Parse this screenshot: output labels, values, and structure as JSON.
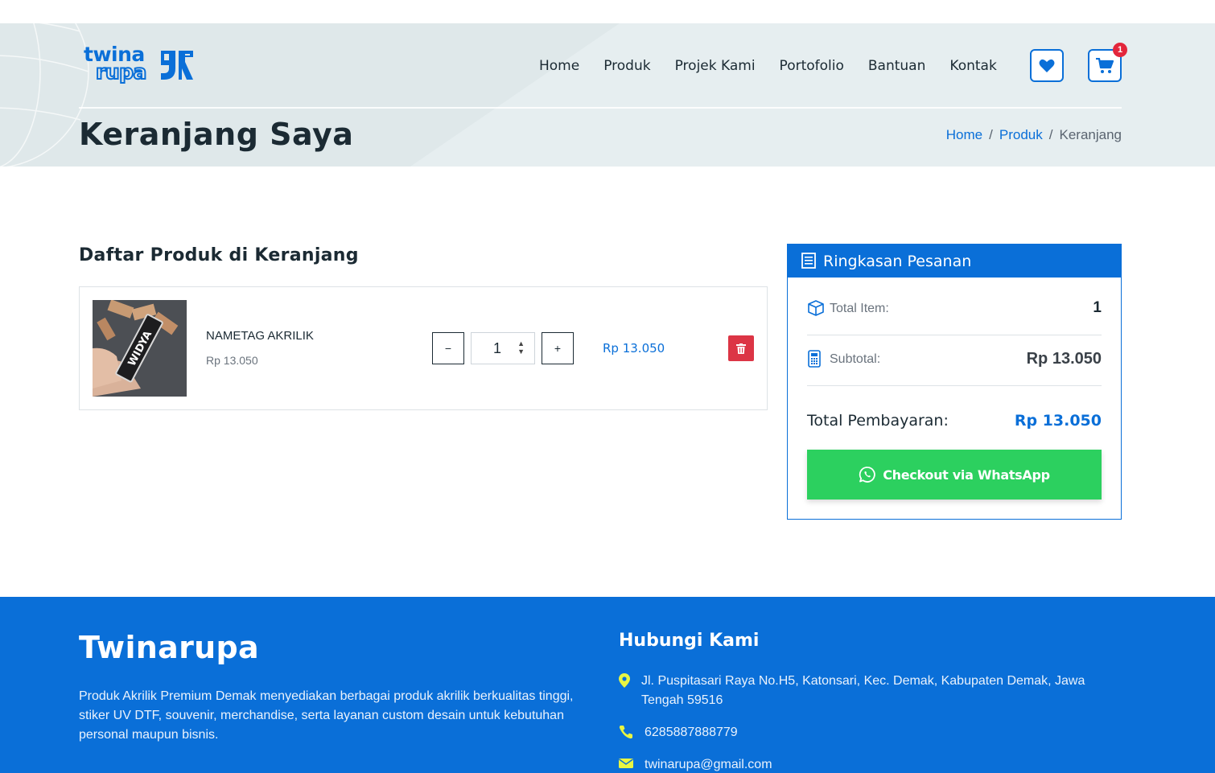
{
  "brand": {
    "logo_line1": "twina",
    "logo_line2": "rupa"
  },
  "nav": {
    "items": [
      {
        "label": "Home"
      },
      {
        "label": "Produk"
      },
      {
        "label": "Projek Kami"
      },
      {
        "label": "Portofolio"
      },
      {
        "label": "Bantuan"
      },
      {
        "label": "Kontak"
      }
    ],
    "wishlist_icon": "heart-icon",
    "cart_icon": "cart-icon",
    "cart_count": "1"
  },
  "header": {
    "title": "Keranjang Saya",
    "breadcrumb": [
      {
        "label": "Home"
      },
      {
        "label": "/"
      },
      {
        "label": "Produk"
      },
      {
        "label": "/"
      },
      {
        "label": "Keranjang"
      }
    ]
  },
  "cart": {
    "section_title": "Daftar Produk di Keranjang",
    "items": [
      {
        "name": "NAMETAG AKRILIK",
        "unit_price": "Rp 13.050",
        "quantity": "1",
        "qty_minus": "−",
        "qty_plus": "+",
        "line_total": "Rp 13.050",
        "image_text": "WIDYA"
      }
    ]
  },
  "summary": {
    "title": "Ringkasan Pesanan",
    "total_item_label": "Total Item:",
    "total_item_value": "1",
    "subtotal_label": "Subtotal:",
    "subtotal_value": "Rp 13.050",
    "payment_label": "Total Pembayaran:",
    "payment_value": "Rp 13.050",
    "checkout_label": "Checkout via WhatsApp"
  },
  "footer": {
    "brand": "Twinarupa",
    "description": "Produk Akrilik Premium Demak menyediakan berbagai produk akrilik berkualitas tinggi, stiker UV DTF, souvenir, merchandise, serta layanan custom desain untuk kebutuhan personal maupun bisnis.",
    "contact_heading": "Hubungi Kami",
    "address": "Jl. Puspitasari Raya No.H5, Katonsari, Kec. Demak, Kabupaten Demak, Jawa Tengah 59516",
    "phone": "6285887888779",
    "email": "twinarupa@gmail.com"
  },
  "colors": {
    "primary": "#0a6fd8",
    "danger": "#dc3545",
    "whatsapp": "#2cd05f",
    "header_bg": "#dfe8ea"
  }
}
